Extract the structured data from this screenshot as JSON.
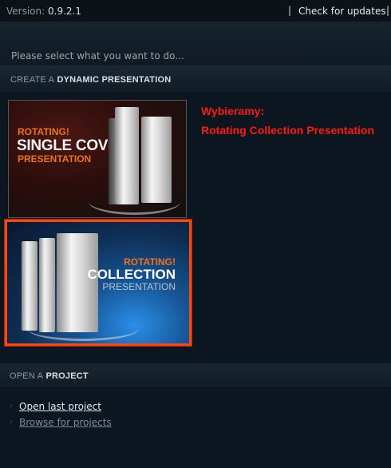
{
  "topbar": {
    "version_label": "Version:",
    "version_number": "0.9.2.1",
    "separator": "|",
    "check_updates": "Check for updates"
  },
  "prompt": "Please select what you want to do...",
  "sections": {
    "create": {
      "prefix": "CREATE A",
      "title": "DYNAMIC PRESENTATION"
    },
    "open": {
      "prefix": "OPEN A",
      "title": "PROJECT"
    }
  },
  "cards": [
    {
      "line1": "ROTATING!",
      "line2": "SINGLE COVER",
      "line3": "PRESENTATION",
      "selected": false
    },
    {
      "line1": "ROTATING!",
      "line2": "COLLECTION",
      "line3": "PRESENTATION",
      "selected": true
    }
  ],
  "annotation": {
    "line1": "Wybieramy:",
    "line2": "Rotating Collection Presentation",
    "color": "#ff1a12"
  },
  "project_links": {
    "open_last": "Open last project",
    "browse": "Browse for projects"
  },
  "colors": {
    "accent_orange": "#f1721c",
    "selection_border": "#f14b12",
    "background": "#0b1620"
  }
}
